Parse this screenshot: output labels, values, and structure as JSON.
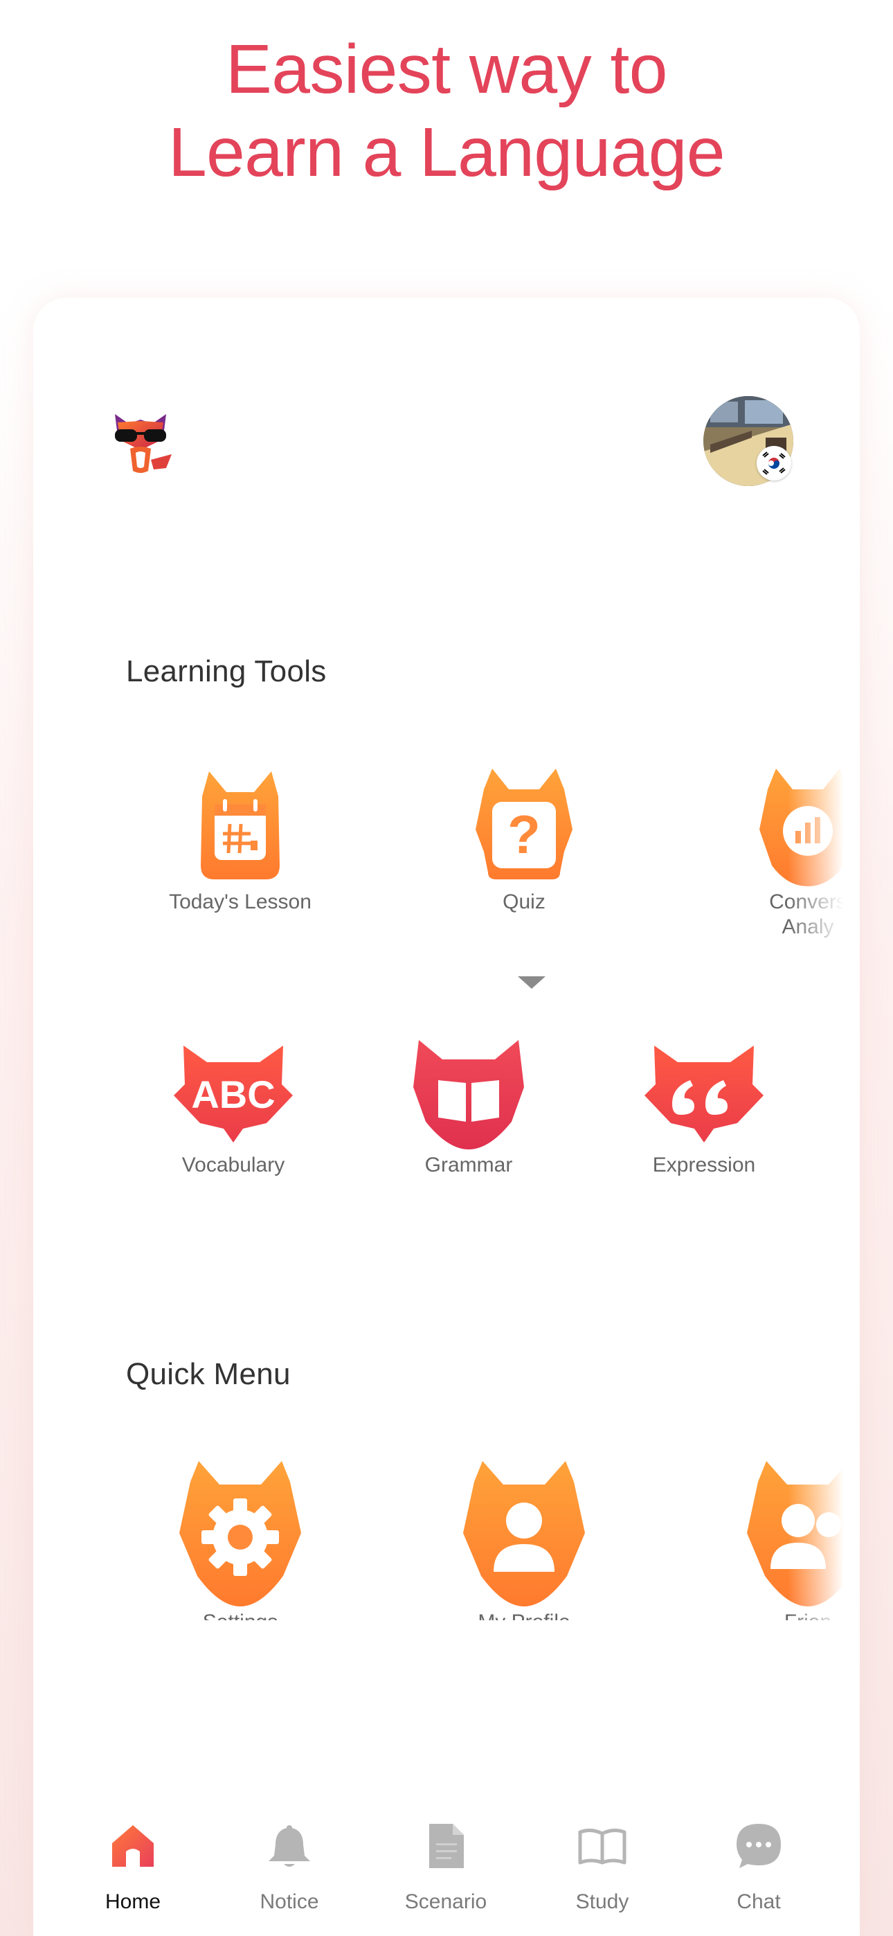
{
  "headline": {
    "line1": "Easiest way to",
    "line2": "Learn a Language"
  },
  "header": {
    "logo_icon": "fox-sunglasses-logo",
    "avatar_icon": "profile-photo",
    "flag_icon": "korea-flag"
  },
  "learning_tools": {
    "title": "Learning Tools",
    "row1": [
      {
        "label": "Today's Lesson",
        "icon": "calendar-icon"
      },
      {
        "label": "Quiz",
        "icon": "question-icon"
      },
      {
        "label": "Convers\nAnaly",
        "icon": "chart-icon"
      }
    ],
    "row2": [
      {
        "label": "Vocabulary",
        "icon": "abc-icon"
      },
      {
        "label": "Grammar",
        "icon": "book-icon"
      },
      {
        "label": "Expression",
        "icon": "quote-icon"
      }
    ]
  },
  "quick_menu": {
    "title": "Quick Menu",
    "items": [
      {
        "label": "Settings",
        "icon": "gear-icon"
      },
      {
        "label": "My Profile",
        "icon": "person-icon"
      },
      {
        "label": "Frien",
        "icon": "friends-icon"
      }
    ]
  },
  "tabbar": {
    "items": [
      {
        "label": "Home",
        "icon": "home-icon",
        "active": true
      },
      {
        "label": "Notice",
        "icon": "bell-icon",
        "active": false
      },
      {
        "label": "Scenario",
        "icon": "document-icon",
        "active": false
      },
      {
        "label": "Study",
        "icon": "open-book-icon",
        "active": false
      },
      {
        "label": "Chat",
        "icon": "chat-bubble-icon",
        "active": false
      }
    ]
  },
  "colors": {
    "accent_orange": "#ff8a3a",
    "accent_red": "#e8404e",
    "headline": "#e3445a",
    "inactive": "#b5b5b5"
  }
}
